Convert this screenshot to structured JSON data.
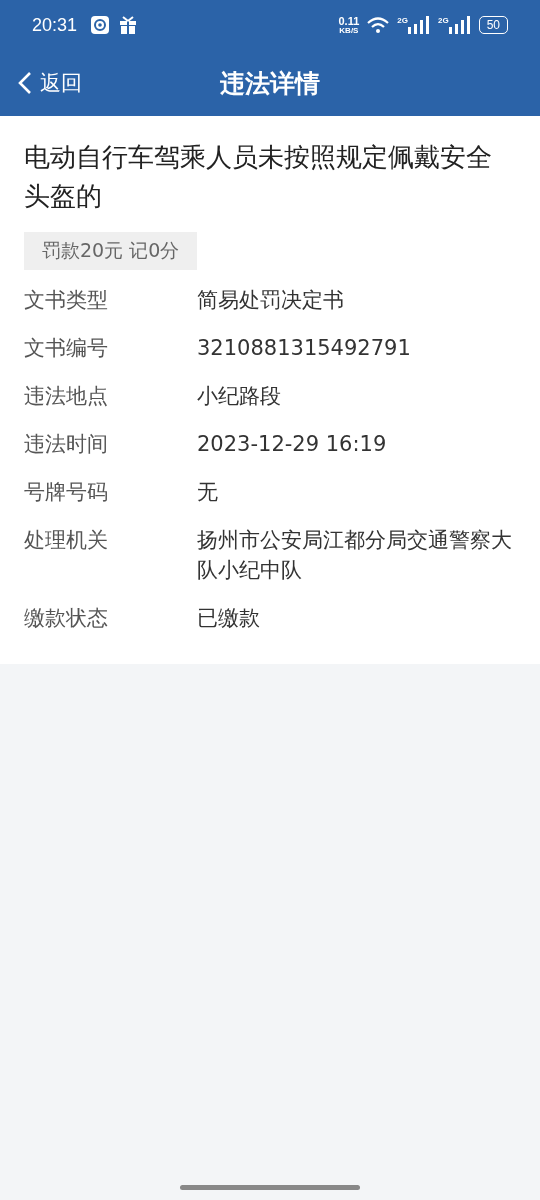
{
  "status_bar": {
    "time": "20:31",
    "speed": "0.11",
    "speed_unit": "KB/S",
    "networks": [
      "2G",
      "2G"
    ],
    "battery": "50"
  },
  "nav": {
    "back": "返回",
    "title": "违法详情"
  },
  "violation": {
    "title": "电动自行车驾乘人员未按照规定佩戴安全头盔的",
    "penalty": "罚款20元 记0分",
    "fields": [
      {
        "label": "文书类型",
        "value": "简易处罚决定书"
      },
      {
        "label": "文书编号",
        "value": "3210881315492791"
      },
      {
        "label": "违法地点",
        "value": "小纪路段"
      },
      {
        "label": "违法时间",
        "value": "2023-12-29 16:19"
      },
      {
        "label": "号牌号码",
        "value": "无"
      },
      {
        "label": "处理机关",
        "value": "扬州市公安局江都分局交通警察大队小纪中队"
      },
      {
        "label": "缴款状态",
        "value": "已缴款"
      }
    ]
  }
}
